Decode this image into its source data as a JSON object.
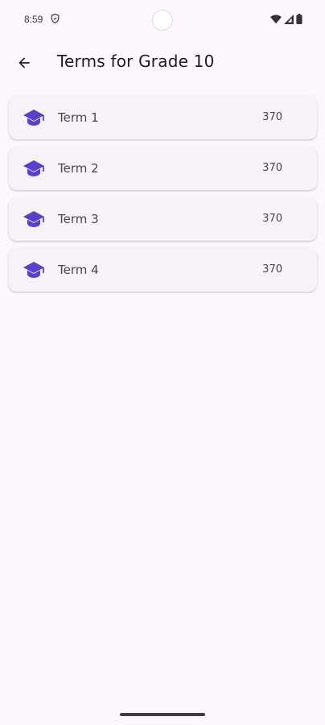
{
  "status_bar": {
    "time": "8:59"
  },
  "app_bar": {
    "title": "Terms for Grade 10"
  },
  "terms": [
    {
      "label": "Term 1",
      "count": "370"
    },
    {
      "label": "Term 2",
      "count": "370"
    },
    {
      "label": "Term 3",
      "count": "370"
    },
    {
      "label": "Term 4",
      "count": "370"
    }
  ],
  "icons": {
    "back": "arrow-back-icon",
    "term": "graduation-cap-icon"
  },
  "colors": {
    "background": "#FDF7FD",
    "card": "#F7F1F8",
    "accent": "#5B3FC9",
    "text": "#1C1B1F",
    "secondary_text": "#49454F"
  }
}
